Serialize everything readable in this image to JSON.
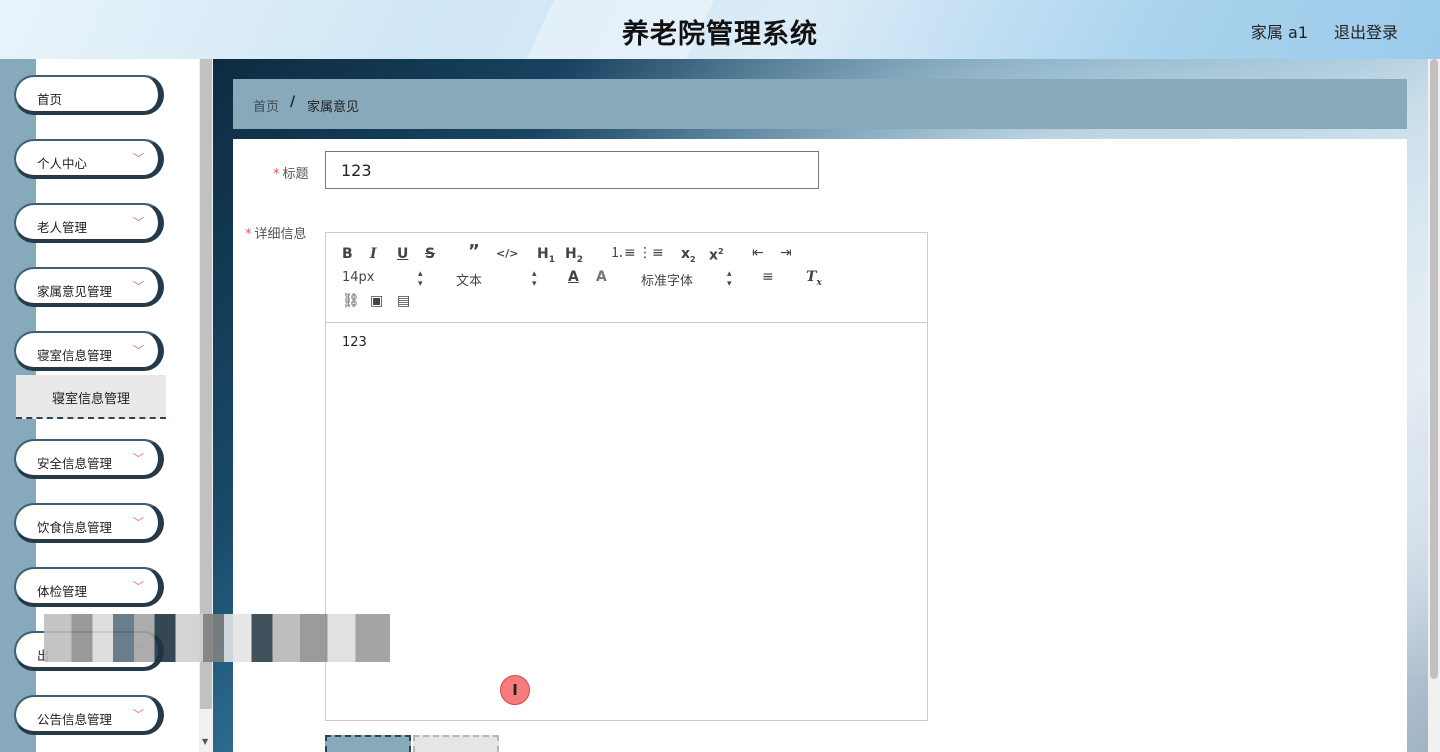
{
  "header": {
    "title": "养老院管理系统",
    "user": "家属 a1",
    "logout": "退出登录"
  },
  "sidebar": {
    "items": [
      {
        "label": "首页",
        "has_chevron": false
      },
      {
        "label": "个人中心",
        "has_chevron": true
      },
      {
        "label": "老人管理",
        "has_chevron": true
      },
      {
        "label": "家属意见管理",
        "has_chevron": true
      },
      {
        "label": "寝室信息管理",
        "has_chevron": true,
        "expanded": true
      },
      {
        "label": "安全信息管理",
        "has_chevron": true
      },
      {
        "label": "饮食信息管理",
        "has_chevron": true
      },
      {
        "label": "体检管理",
        "has_chevron": true
      },
      {
        "label": "出",
        "has_chevron": true
      },
      {
        "label": "公告信息管理",
        "has_chevron": true
      }
    ],
    "submenu": {
      "label": "寝室信息管理"
    }
  },
  "breadcrumb": {
    "home": "首页",
    "separator": "/",
    "current": "家属意见"
  },
  "form": {
    "title_label": "标题",
    "title_value": "123",
    "detail_label": "详细信息",
    "required_mark": "*",
    "editor": {
      "font_size": "14px",
      "paragraph": "文本",
      "font_family": "标准字体",
      "content": "123"
    }
  },
  "icons": {
    "chevron": "chevron-down-icon",
    "text_cursor": "text-cursor-icon"
  },
  "colors": {
    "accent": "#87a9ba",
    "dark": "#24394a",
    "required": "#ee5555"
  }
}
